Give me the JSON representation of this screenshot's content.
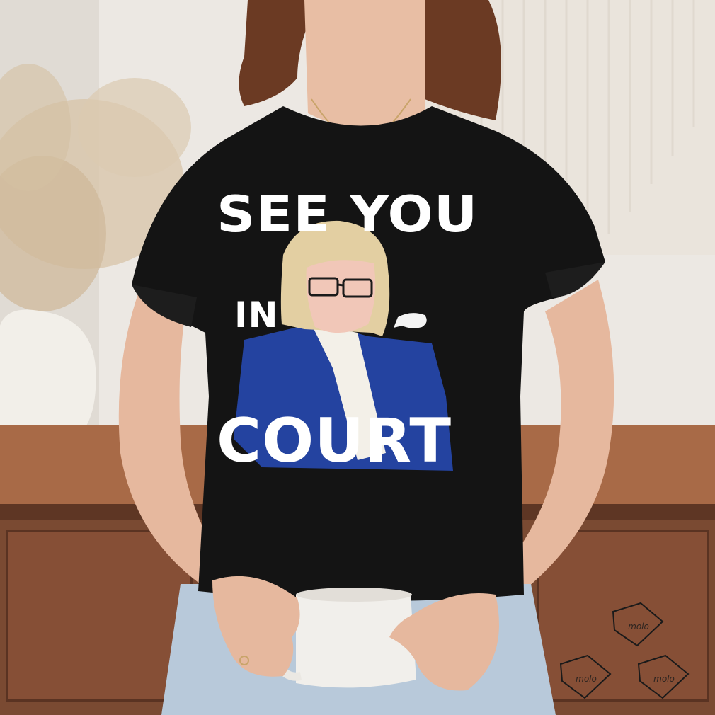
{
  "photo": {
    "subject": "woman-wearing-black-tshirt-holding-mug",
    "colors": {
      "wall": "#ece8e3",
      "dresser": "#7a4a32",
      "shirt": "#141414",
      "jeans": "#b8c9da",
      "blazer": "#2443a0",
      "hair": "#e3cfa2"
    }
  },
  "shirt_print": {
    "line1": "SEE YOU",
    "line2": "IN",
    "line3": "COURT"
  },
  "watermark": {
    "text": "molo",
    "count": 3
  }
}
